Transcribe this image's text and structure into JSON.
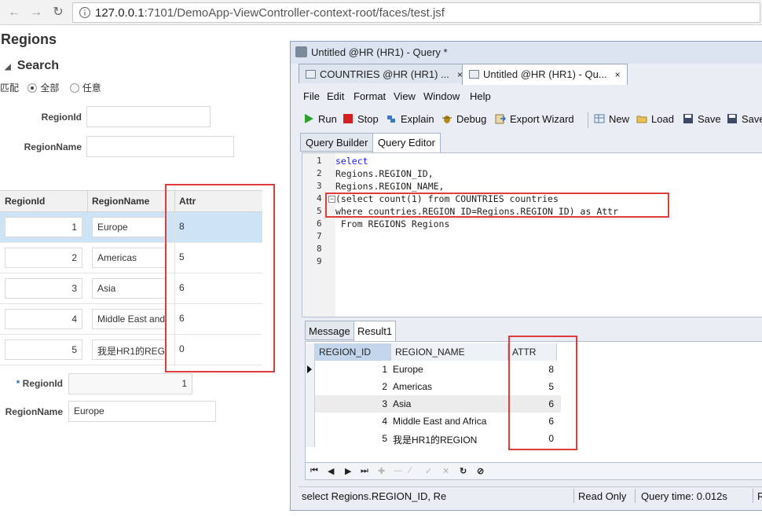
{
  "browser": {
    "url_host": "127.0.0.1",
    "url_path": ":7101/DemoApp-ViewController-context-root/faces/test.jsf"
  },
  "adf": {
    "page_title": "Regions",
    "search_header": "Search",
    "match_label": "匹配",
    "match_all": "全部",
    "match_any": "任意",
    "region_id_label": "RegionId",
    "region_name_label": "RegionName",
    "columns": [
      "RegionId",
      "RegionName",
      "Attr"
    ],
    "rows": [
      {
        "id": "1",
        "name": "Europe",
        "attr": "8"
      },
      {
        "id": "2",
        "name": "Americas",
        "attr": "5"
      },
      {
        "id": "3",
        "name": "Asia",
        "attr": "6"
      },
      {
        "id": "4",
        "name": "Middle East and",
        "attr": "6"
      },
      {
        "id": "5",
        "name": "我是HR1的REG",
        "attr": "0"
      }
    ],
    "detail": {
      "required_mark": "*",
      "region_id_label": "RegionId",
      "region_id_value": "1",
      "region_name_label": "RegionName",
      "region_name_value": "Europe"
    }
  },
  "jdev": {
    "window_title": "Untitled @HR (HR1) - Query *",
    "tabs": [
      {
        "label": "COUNTRIES @HR (HR1) ...",
        "close": "×"
      },
      {
        "label": "Untitled @HR (HR1) - Qu...",
        "close": "×"
      }
    ],
    "menu": [
      "File",
      "Edit",
      "Format",
      "View",
      "Window",
      "Help"
    ],
    "toolbar": {
      "run": "Run",
      "stop": "Stop",
      "explain": "Explain",
      "debug": "Debug",
      "export": "Export Wizard",
      "new": "New",
      "load": "Load",
      "save": "Save",
      "save_as": "Save"
    },
    "sub_tabs": [
      "Query Builder",
      "Query Editor"
    ],
    "line_numbers": [
      "1",
      "2",
      "3",
      "4",
      "5",
      "6",
      "7",
      "8",
      "9"
    ],
    "code": [
      "select",
      "Regions.REGION_ID,",
      "Regions.REGION_NAME,",
      "(select count(1) from COUNTRIES countries",
      "where countries.REGION_ID=Regions.REGION_ID) as Attr",
      " From REGIONS Regions"
    ],
    "result_tabs": [
      "Message",
      "Result1"
    ],
    "result_columns": [
      "REGION_ID",
      "REGION_NAME",
      "ATTR"
    ],
    "result_rows": [
      {
        "id": "1",
        "name": "Europe",
        "attr": "8"
      },
      {
        "id": "2",
        "name": "Americas",
        "attr": "5"
      },
      {
        "id": "3",
        "name": "Asia",
        "attr": "6"
      },
      {
        "id": "4",
        "name": "Middle East and Africa",
        "attr": "6"
      },
      {
        "id": "5",
        "name": "我是HR1的REGION",
        "attr": "0"
      }
    ],
    "status": {
      "sql": "select  Regions.REGION_ID, Re",
      "mode": "Read Only",
      "query_time": "Query time: 0.012s",
      "extra": "Re"
    }
  },
  "colors": {
    "highlight_red": "#e03c3c",
    "selected_row": "#cde3f6",
    "keyword_blue": "#1a1aff"
  }
}
